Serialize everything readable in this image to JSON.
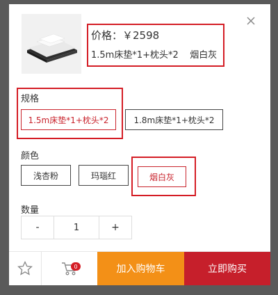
{
  "product": {
    "price_label": "价格：￥2598",
    "selected_sku": "1.5m床垫*1+枕头*2    烟白灰"
  },
  "spec": {
    "title": "规格",
    "options": [
      "1.5m床垫*1+枕头*2",
      "1.8m床垫*1+枕头*2"
    ],
    "selected": "1.5m床垫*1+枕头*2"
  },
  "color": {
    "title": "颜色",
    "options": [
      "浅杏粉",
      "玛瑙红",
      "烟白灰"
    ],
    "selected": "烟白灰"
  },
  "quantity": {
    "title": "数量",
    "minus": "-",
    "value": "1",
    "plus": "+"
  },
  "bottom_bar": {
    "cart_count": "0",
    "add_to_cart": "加入购物车",
    "buy_now": "立即购买"
  },
  "colors": {
    "accent": "#c61f2b",
    "cart": "#f39017",
    "highlight": "#d41c24"
  }
}
